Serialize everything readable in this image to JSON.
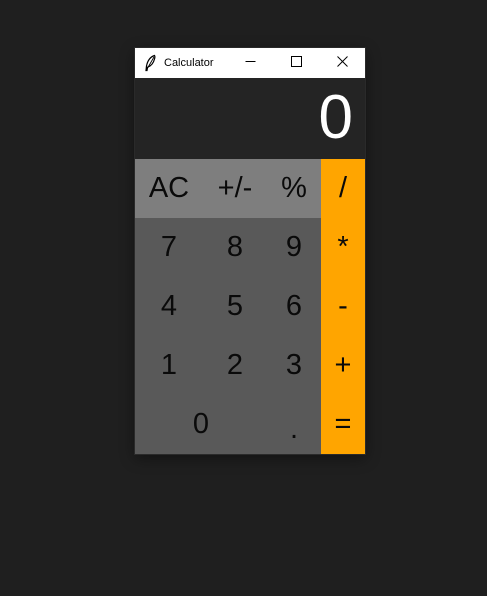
{
  "window": {
    "title": "Calculator",
    "controls": {
      "minimize_icon": "minimize-icon",
      "maximize_icon": "maximize-icon",
      "close_icon": "close-icon"
    }
  },
  "display": {
    "value": "0"
  },
  "keys": {
    "function_row": [
      "AC",
      "+/-",
      "%"
    ],
    "digits": {
      "row1": [
        "7",
        "8",
        "9"
      ],
      "row2": [
        "4",
        "5",
        "6"
      ],
      "row3": [
        "1",
        "2",
        "3"
      ],
      "row4": [
        "0",
        "."
      ]
    },
    "operators": [
      "/",
      "*",
      "-",
      "+",
      "="
    ]
  },
  "colors": {
    "desktop": "#1f1f1f",
    "display_bg": "#242424",
    "function_bg": "#7e7e7e",
    "digit_bg": "#595959",
    "operator_bg": "#ffa500",
    "display_text": "#ffffff",
    "key_text": "#0a0a0a"
  }
}
